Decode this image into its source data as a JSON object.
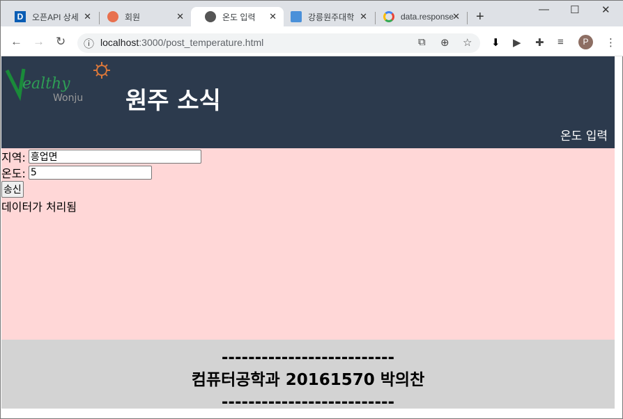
{
  "browser": {
    "tabs": [
      {
        "label": "오픈API 상세",
        "icon": "d-logo-icon",
        "active": false
      },
      {
        "label": "회원",
        "icon": "orange-avatar-icon",
        "active": false
      },
      {
        "label": "온도 입력",
        "icon": "globe-icon",
        "active": true
      },
      {
        "label": "강릉원주대학",
        "icon": "notepad-icon",
        "active": false
      },
      {
        "label": "data.response",
        "icon": "google-icon",
        "active": false
      }
    ],
    "url_host": "localhost",
    "url_path": ":3000/post_temperature.html",
    "profile_initial": "P"
  },
  "header": {
    "logo_text": "Healthy Wonju",
    "title": "원주 소식",
    "nav_link": "온도 입력"
  },
  "form": {
    "region_label": "지역:",
    "region_value": "흥업면",
    "temp_label": "온도:",
    "temp_value": "5",
    "submit_label": "송신",
    "status": "데이터가 처리됨"
  },
  "footer": {
    "divider_top": "--------------------------",
    "credit": "컴퓨터공학과 20161570 박의찬",
    "divider_bottom": "--------------------------"
  },
  "colors": {
    "header_bg": "#2c3a4d",
    "content_bg": "#ffd7d7",
    "footer_bg": "#d3d3d3"
  }
}
